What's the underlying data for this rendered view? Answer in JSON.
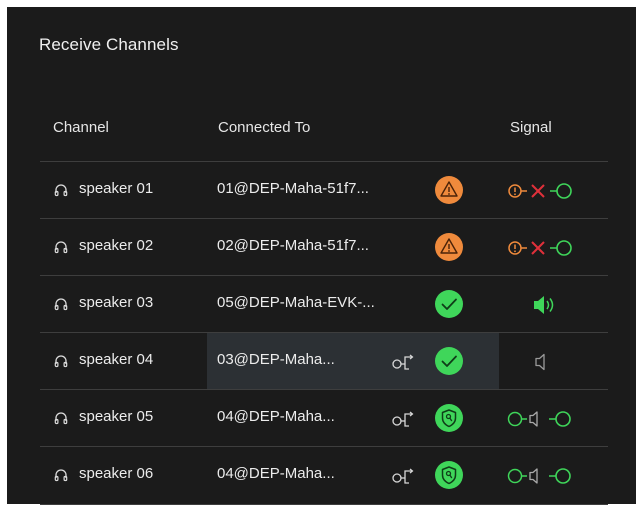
{
  "panel": {
    "title": "Receive Channels"
  },
  "columns": {
    "channel": "Channel",
    "connected_to": "Connected To",
    "signal": "Signal"
  },
  "colors": {
    "background": "#1b1b1b",
    "warning": "#ef8a3c",
    "ok": "#3fd65a",
    "error": "#e0303a",
    "signal_green": "#3fd65a",
    "selected_row": "#2c3034"
  },
  "channels": [
    {
      "name": "speaker 01",
      "connected_to": "01@DEP-Maha-51f7...",
      "status_icon": "warning-icon",
      "signal_icon": "signal-error-icon",
      "route_icon": ""
    },
    {
      "name": "speaker 02",
      "connected_to": "02@DEP-Maha-51f7...",
      "status_icon": "warning-icon",
      "signal_icon": "signal-error-icon",
      "route_icon": ""
    },
    {
      "name": "speaker 03",
      "connected_to": "05@DEP-Maha-EVK-...",
      "status_icon": "check-icon",
      "signal_icon": "speaker-active-icon",
      "route_icon": ""
    },
    {
      "name": "speaker 04",
      "connected_to": "03@DEP-Maha...",
      "status_icon": "check-icon",
      "signal_icon": "speaker-idle-icon",
      "route_icon": "route-icon",
      "selected": true
    },
    {
      "name": "speaker 05",
      "connected_to": "04@DEP-Maha...",
      "status_icon": "secure-check-icon",
      "signal_icon": "signal-connected-icon",
      "route_icon": "route-icon"
    },
    {
      "name": "speaker 06",
      "connected_to": "04@DEP-Maha...",
      "status_icon": "secure-check-icon",
      "signal_icon": "signal-connected-icon",
      "route_icon": "route-icon"
    }
  ]
}
